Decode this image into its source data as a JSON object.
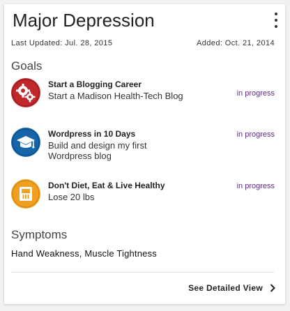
{
  "card": {
    "title": "Major Depression",
    "last_updated": "Last Updated: Jul. 28, 2015",
    "added": "Added: Oct. 21, 2014"
  },
  "goals": {
    "heading": "Goals",
    "items": [
      {
        "title": "Start a Blogging Career",
        "description": "Start a Madison Health-Tech Blog",
        "status": "in progress",
        "icon": "gears-icon",
        "color": "#c0282c"
      },
      {
        "title": "Wordpress in 10 Days",
        "description": "Build and design my first Wordpress blog",
        "status": "in progress",
        "icon": "graduation-cap-icon",
        "color": "#1565a8"
      },
      {
        "title": "Don't Diet, Eat & Live Healthy",
        "description": "Lose 20 lbs",
        "status": "in progress",
        "icon": "scale-icon",
        "color": "#f0a020"
      }
    ]
  },
  "symptoms": {
    "heading": "Symptoms",
    "text": "Hand Weakness, Muscle Tightness"
  },
  "footer": {
    "link_label": "See Detailed View"
  },
  "colors": {
    "status": "#5e2a86",
    "background": "#f1f1f1",
    "card": "#ffffff"
  }
}
